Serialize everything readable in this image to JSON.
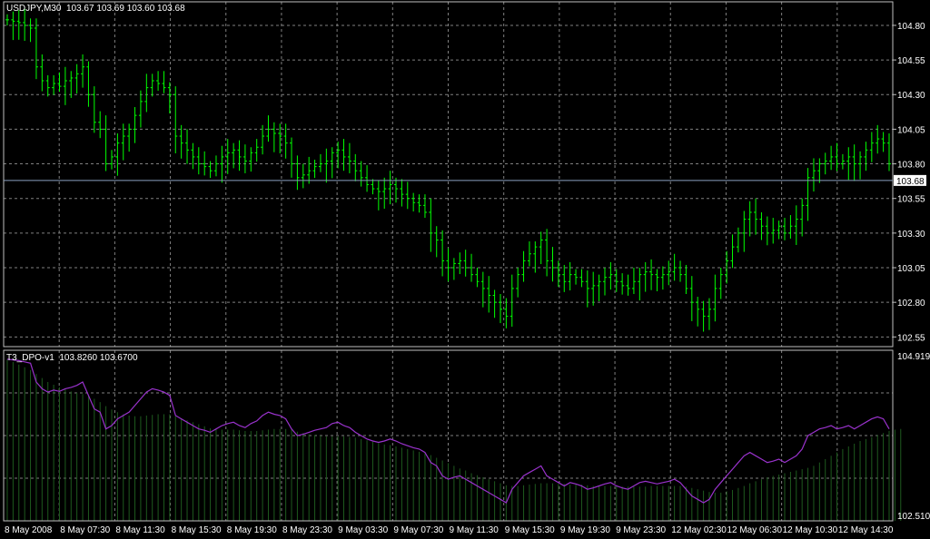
{
  "window": {
    "symbol_title": "USDJPY,M30",
    "ohlc_text": "103.67 103.69 103.60 103.68",
    "indicator_title": "T3_DPO-v1",
    "indicator_values": "103.8260 103.6700"
  },
  "colors": {
    "background": "#000000",
    "grid": "#808080",
    "bars": "#00ff00",
    "indicator_line": "#9932cc",
    "histogram": "#1e5a1e",
    "current_price_line": "#8aa0c0",
    "axis_text": "#ffffff"
  },
  "chart_data": [
    {
      "type": "ohlc",
      "title": "USDJPY,M30",
      "y_ticks": [
        "104.80",
        "104.55",
        "104.30",
        "104.05",
        "103.80",
        "103.55",
        "103.30",
        "103.05",
        "102.80",
        "102.55"
      ],
      "ylim": [
        102.48,
        104.97
      ],
      "current_price": 103.68,
      "current_price_label": "103.68",
      "x_ticks": [
        "8 May 2008",
        "8 May 07:30",
        "8 May 11:30",
        "8 May 15:30",
        "8 May 19:30",
        "8 May 23:30",
        "9 May 03:30",
        "9 May 07:30",
        "9 May 11:30",
        "9 May 15:30",
        "9 May 19:30",
        "9 May 23:30",
        "12 May 02:30",
        "12 May 06:30",
        "12 May 10:30",
        "12 May 14:30"
      ],
      "close": [
        104.84,
        104.83,
        104.82,
        104.8,
        104.78,
        104.5,
        104.4,
        104.35,
        104.38,
        104.36,
        104.4,
        104.42,
        104.45,
        104.5,
        104.3,
        104.1,
        104.05,
        103.8,
        103.85,
        103.95,
        104.0,
        104.05,
        104.15,
        104.25,
        104.35,
        104.4,
        104.38,
        104.35,
        104.3,
        104.0,
        103.95,
        103.9,
        103.85,
        103.8,
        103.78,
        103.75,
        103.8,
        103.85,
        103.88,
        103.9,
        103.85,
        103.82,
        103.88,
        103.92,
        104.0,
        104.05,
        104.02,
        104.0,
        103.95,
        103.8,
        103.7,
        103.72,
        103.75,
        103.78,
        103.8,
        103.82,
        103.88,
        103.9,
        103.85,
        103.82,
        103.75,
        103.7,
        103.65,
        103.62,
        103.6,
        103.62,
        103.65,
        103.62,
        103.58,
        103.55,
        103.52,
        103.5,
        103.45,
        103.3,
        103.25,
        103.1,
        103.05,
        103.08,
        103.1,
        103.05,
        103.0,
        102.95,
        102.9,
        102.85,
        102.8,
        102.75,
        102.7,
        102.9,
        103.0,
        103.1,
        103.15,
        103.2,
        103.25,
        103.1,
        103.05,
        103.0,
        102.95,
        103.0,
        102.98,
        102.95,
        102.9,
        102.92,
        102.95,
        102.98,
        103.0,
        102.95,
        102.92,
        102.9,
        102.95,
        103.0,
        103.02,
        103.0,
        102.98,
        103.0,
        103.02,
        103.05,
        103.0,
        102.9,
        102.8,
        102.75,
        102.7,
        102.75,
        102.9,
        103.0,
        103.1,
        103.2,
        103.3,
        103.4,
        103.45,
        103.4,
        103.35,
        103.3,
        103.32,
        103.35,
        103.3,
        103.35,
        103.4,
        103.5,
        103.7,
        103.75,
        103.8,
        103.82,
        103.85,
        103.8,
        103.82,
        103.85,
        103.8,
        103.85,
        103.9,
        103.95,
        103.98,
        103.95,
        103.8
      ]
    },
    {
      "type": "line+histogram",
      "title": "T3_DPO-v1",
      "y_ticks": [
        "104.9195",
        "102.5105"
      ],
      "ylim": [
        102.5105,
        104.9195
      ],
      "series": [
        {
          "name": "T3_DPO-v1",
          "values": [
            104.84,
            104.83,
            104.82,
            104.8,
            104.78,
            104.5,
            104.4,
            104.35,
            104.38,
            104.36,
            104.4,
            104.42,
            104.45,
            104.5,
            104.3,
            104.1,
            104.05,
            103.8,
            103.85,
            103.95,
            104.0,
            104.05,
            104.15,
            104.25,
            104.35,
            104.4,
            104.38,
            104.35,
            104.3,
            104.0,
            103.95,
            103.9,
            103.85,
            103.8,
            103.78,
            103.75,
            103.8,
            103.85,
            103.88,
            103.9,
            103.85,
            103.82,
            103.88,
            103.92,
            104.0,
            104.05,
            104.02,
            104.0,
            103.95,
            103.8,
            103.7,
            103.72,
            103.75,
            103.78,
            103.8,
            103.82,
            103.88,
            103.9,
            103.85,
            103.82,
            103.75,
            103.7,
            103.65,
            103.62,
            103.6,
            103.62,
            103.65,
            103.62,
            103.58,
            103.55,
            103.52,
            103.5,
            103.45,
            103.3,
            103.25,
            103.1,
            103.05,
            103.08,
            103.1,
            103.05,
            103.0,
            102.95,
            102.9,
            102.85,
            102.8,
            102.75,
            102.7,
            102.9,
            103.0,
            103.1,
            103.15,
            103.2,
            103.25,
            103.1,
            103.05,
            103.0,
            102.95,
            103.0,
            102.98,
            102.95,
            102.9,
            102.92,
            102.95,
            102.98,
            103.0,
            102.95,
            102.92,
            102.9,
            102.95,
            103.0,
            103.02,
            103.0,
            102.98,
            103.0,
            103.02,
            103.05,
            103.0,
            102.9,
            102.8,
            102.75,
            102.7,
            102.75,
            102.9,
            103.0,
            103.1,
            103.2,
            103.3,
            103.4,
            103.45,
            103.4,
            103.35,
            103.3,
            103.32,
            103.35,
            103.3,
            103.35,
            103.4,
            103.5,
            103.7,
            103.75,
            103.8,
            103.82,
            103.85,
            103.8,
            103.82,
            103.85,
            103.8,
            103.85,
            103.9,
            103.95,
            103.98,
            103.95,
            103.8
          ]
        },
        {
          "name": "103.6700",
          "values": [
            104.84,
            104.8,
            104.76,
            104.72,
            104.68,
            104.62,
            104.56,
            104.5,
            104.46,
            104.42,
            104.39,
            104.36,
            104.34,
            104.32,
            104.29,
            104.25,
            104.2,
            104.14,
            104.09,
            104.05,
            104.02,
            104.0,
            103.99,
            103.99,
            104.0,
            104.01,
            104.02,
            104.02,
            104.02,
            103.99,
            103.96,
            103.93,
            103.9,
            103.87,
            103.84,
            103.81,
            103.8,
            103.79,
            103.79,
            103.79,
            103.78,
            103.77,
            103.77,
            103.77,
            103.78,
            103.79,
            103.8,
            103.8,
            103.8,
            103.79,
            103.76,
            103.74,
            103.72,
            103.71,
            103.7,
            103.69,
            103.69,
            103.69,
            103.69,
            103.68,
            103.67,
            103.65,
            103.63,
            103.61,
            103.59,
            103.57,
            103.56,
            103.54,
            103.52,
            103.5,
            103.48,
            103.46,
            103.44,
            103.41,
            103.37,
            103.33,
            103.29,
            103.25,
            103.21,
            103.18,
            103.14,
            103.11,
            103.08,
            103.05,
            103.02,
            102.99,
            102.96,
            102.95,
            102.95,
            102.96,
            102.97,
            102.98,
            102.99,
            102.99,
            102.99,
            102.98,
            102.98,
            102.97,
            102.97,
            102.97,
            102.96,
            102.95,
            102.95,
            102.95,
            102.95,
            102.95,
            102.94,
            102.94,
            102.94,
            102.94,
            102.94,
            102.95,
            102.95,
            102.95,
            102.95,
            102.95,
            102.95,
            102.94,
            102.92,
            102.9,
            102.88,
            102.86,
            102.85,
            102.85,
            102.87,
            102.89,
            102.92,
            102.95,
            102.99,
            103.02,
            103.05,
            103.08,
            103.1,
            103.12,
            103.14,
            103.16,
            103.18,
            103.2,
            103.22,
            103.25,
            103.3,
            103.35,
            103.4,
            103.45,
            103.5,
            103.54,
            103.58,
            103.62,
            103.65,
            103.68,
            103.71,
            103.74,
            103.77,
            103.79,
            103.8
          ]
        }
      ]
    }
  ]
}
